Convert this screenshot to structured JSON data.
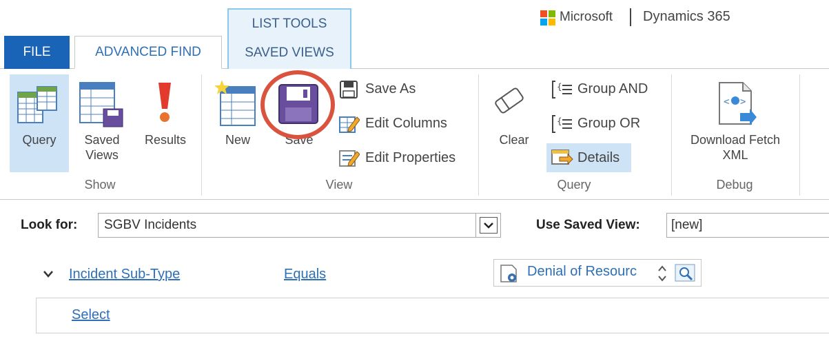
{
  "tabs": {
    "file": "FILE",
    "advanced_find": "ADVANCED FIND",
    "context_group": "LIST TOOLS",
    "saved_views": "SAVED VIEWS"
  },
  "brand": {
    "microsoft": "Microsoft",
    "product": "Dynamics 365",
    "logo_colors": [
      "#f25022",
      "#7fba00",
      "#00a4ef",
      "#ffb900"
    ]
  },
  "ribbon": {
    "show": {
      "label": "Show",
      "query": "Query",
      "saved_views_line1": "Saved",
      "saved_views_line2": "Views",
      "results": "Results"
    },
    "view": {
      "label": "View",
      "new": "New",
      "save": "Save",
      "save_as": "Save As",
      "edit_columns": "Edit Columns",
      "edit_properties": "Edit Properties"
    },
    "query": {
      "label": "Query",
      "clear": "Clear",
      "group_and": "Group AND",
      "group_or": "Group OR",
      "details": "Details"
    },
    "debug": {
      "label": "Debug",
      "download_line1": "Download Fetch",
      "download_line2": "XML"
    }
  },
  "search": {
    "look_for_label": "Look for:",
    "look_for_value": "SGBV Incidents",
    "use_saved_view_label": "Use Saved View:",
    "use_saved_view_value": "[new]"
  },
  "criteria": {
    "field": "Incident Sub-Type",
    "operator": "Equals",
    "value": "Denial of Resourc",
    "select": "Select"
  },
  "colors": {
    "accent": "#1a64b8",
    "link": "#2e6fb5",
    "highlight": "#d9533f",
    "selected": "#cfe3f6"
  }
}
